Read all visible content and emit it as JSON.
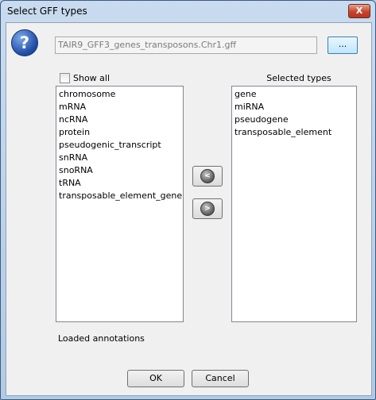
{
  "window": {
    "title": "Select GFF types",
    "close_glyph": "X"
  },
  "help_icon": {
    "glyph": "?",
    "name": "help-icon"
  },
  "file": {
    "value": "TAIR9_GFF3_genes_transposons.Chr1.gff",
    "browse_label": "..."
  },
  "show_all": {
    "label": "Show all",
    "checked": false
  },
  "available_types": [
    "chromosome",
    "mRNA",
    "ncRNA",
    "protein",
    "pseudogenic_transcript",
    "snRNA",
    "snoRNA",
    "tRNA",
    "transposable_element_gene"
  ],
  "selected_types": {
    "label": "Selected types",
    "items": [
      "gene",
      "miRNA",
      "pseudogene",
      "transposable_element"
    ]
  },
  "transfer": {
    "left_glyph": "<",
    "right_glyph": ">"
  },
  "status": {
    "label": "Loaded annotations"
  },
  "buttons": {
    "ok": "OK",
    "cancel": "Cancel"
  }
}
